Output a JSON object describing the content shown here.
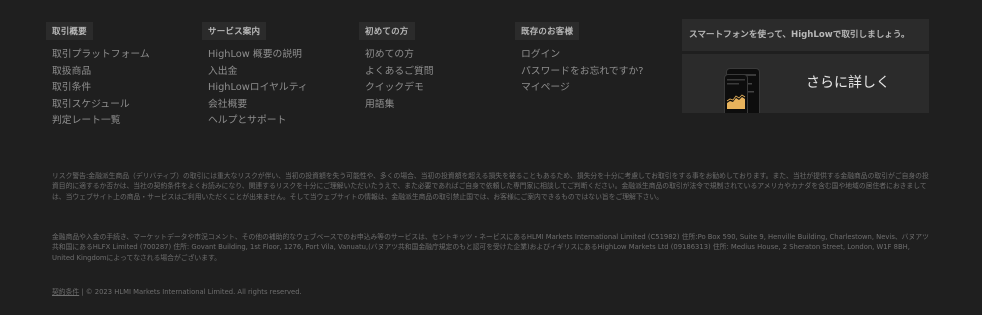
{
  "columns": [
    {
      "heading": "取引概要",
      "items": [
        "取引プラットフォーム",
        "取扱商品",
        "取引条件",
        "取引スケジュール",
        "判定レート一覧"
      ]
    },
    {
      "heading": "サービス案内",
      "items": [
        "HighLow 概要の説明",
        "入出金",
        "HighLowロイヤルティ",
        "会社概要",
        "ヘルプとサポート"
      ]
    },
    {
      "heading": "初めての方",
      "items": [
        "初めての方",
        "よくあるご質問",
        "クイックデモ",
        "用語集"
      ]
    },
    {
      "heading": "既存のお客様",
      "items": [
        "ログイン",
        "パスワードをお忘れですか?",
        "マイページ"
      ]
    }
  ],
  "promo": {
    "headline": "スマートフォンを使って、HighLowで取引しましょう。",
    "cta": "さらに詳しく",
    "phone_icon": "smartphone-app-mockup-image"
  },
  "legal": {
    "risk_warning": "リスク警告:金融派生商品（デリバティブ）の取引には重大なリスクが伴い、当初の投資額を失う可能性や、多くの場合、当初の投資額を超える損失を被ることもあるため、損失分を十分に考慮してお取引をする事をお勧めしております。また、当社が提供する金融商品の取引がご自身の投資目的に適するか否かは、当社の契約条件をよくお読みになり、関連するリスクを十分にご理解いただいたうえで、また必要であればご自身で依頼した専門家に相談してご判断ください。金融派生商品の取引が法令で規制されているアメリカやカナダを含む国や地域の居住者におきましては、当ウェブサイト上の商品・サービスはご利用いただくことが出来ません。そして当ウェブサイトの情報は、金融派生商品の取引禁止国では、お客様にご案内できるものではない旨をご理解下さい。",
    "company_info": "金融商品や入金の手続き、マーケットデータや市況コメント、その他の補助的なウェブベースでのお申込み等のサービスは、セントキッツ・ネービスにあるHLMI Markets International Limited (C51982) 住所:Po Box 590, Suite 9, Henville Building, Charlestown, Nevis、バヌアツ共和国にあるHLFX Limited (700287) 住所: Govant Building, 1st Floor, 1276, Port Vila, Vanuatu,(バヌアツ共和国金融庁規定のもと認可を受けた企業)およびイギリスにあるHighLow Markets Ltd (09186313) 住所: Medius House, 2 Sheraton Street, London, W1F 8BH, United Kingdomによってなされる場合がございます。"
  },
  "footer": {
    "terms_label": "契約条件",
    "copyright": " | © 2023 HLMI Markets International Limited. All rights reserved."
  },
  "colors": {
    "background": "#1f1f1f",
    "panel": "#2b2b2b",
    "chart_accent": "#e8b35c"
  }
}
